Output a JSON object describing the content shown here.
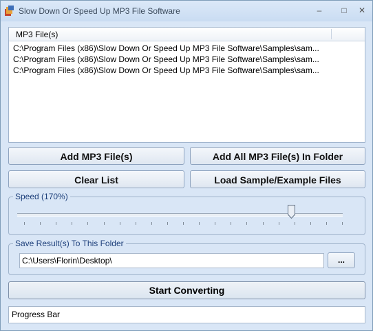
{
  "window": {
    "title": "Slow Down Or Speed Up MP3 File Software",
    "controls": [
      "minimize",
      "maximize",
      "close"
    ]
  },
  "file_list": {
    "column_header": "MP3 File(s)",
    "rows": [
      "C:\\Program Files (x86)\\Slow Down Or Speed Up MP3 File Software\\Samples\\sam...",
      "C:\\Program Files (x86)\\Slow Down Or Speed Up MP3 File Software\\Samples\\sam...",
      "C:\\Program Files (x86)\\Slow Down Or Speed Up MP3 File Software\\Samples\\sam..."
    ]
  },
  "buttons": {
    "add_files": "Add MP3 File(s)",
    "add_folder": "Add All MP3 File(s) In Folder",
    "clear_list": "Clear List",
    "load_samples": "Load Sample/Example Files",
    "browse": "...",
    "start": "Start Converting"
  },
  "speed": {
    "label": "Speed (170%)",
    "slider_fraction": 0.84,
    "tick_count": 21
  },
  "output_folder": {
    "label": "Save Result(s) To This Folder",
    "value": "C:\\Users\\Florin\\Desktop\\"
  },
  "progress": {
    "label": "Progress Bar"
  },
  "colors": {
    "accent_label": "#1d3f7a",
    "window_bg": "#d9e6f6"
  },
  "icons": {
    "app": "app-icon"
  }
}
